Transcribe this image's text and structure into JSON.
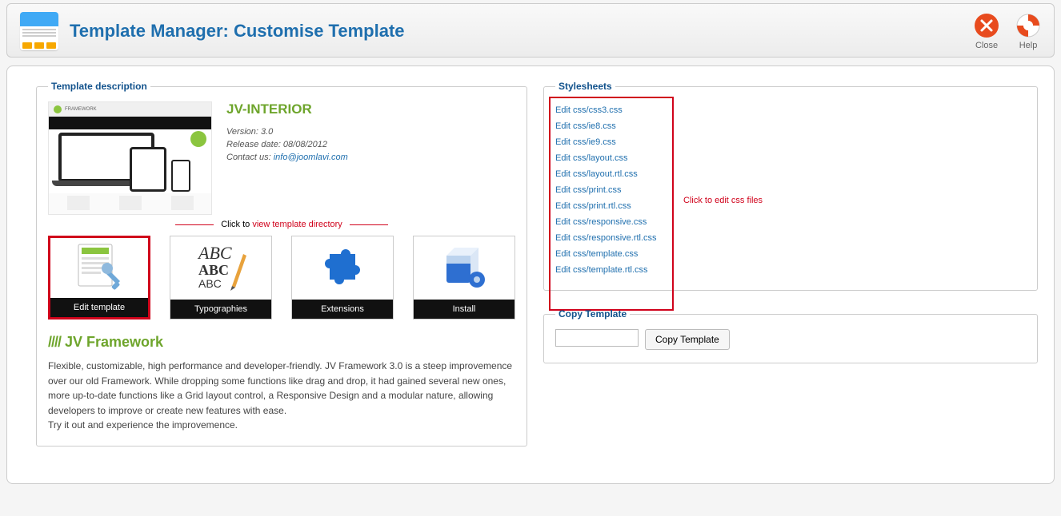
{
  "header": {
    "title": "Template Manager: Customise Template",
    "close_label": "Close",
    "help_label": "Help"
  },
  "desc": {
    "legend": "Template description",
    "template_name": "JV-INTERIOR",
    "version_label": "Version: 3.0",
    "release_label": "Release date: 08/08/2012",
    "contact_label": "Contact us: ",
    "contact_email": "info@joomlavi.com",
    "annot_prefix": "Click to ",
    "annot_text": "view template directory",
    "cards": {
      "edit_template": "Edit template",
      "typographies": "Typographies",
      "extensions": "Extensions",
      "install": "Install"
    },
    "framework_prefix": "////",
    "framework_title": " JV Framework",
    "body1": "Flexible, customizable, high performance and developer-friendly. JV Framework 3.0 is a steep improvemence over our old Framework. While dropping some functions like drag and drop, it had gained several new ones, more up-to-date functions like a Grid layout control, a Responsive Design and a modular nature, allowing developers to improve or create new features with ease.",
    "body2": "Try it out and experience the improvemence."
  },
  "stylesheets": {
    "legend": "Stylesheets",
    "annot": "Click to edit css files",
    "items": [
      "Edit css/css3.css",
      "Edit css/ie8.css",
      "Edit css/ie9.css",
      "Edit css/layout.css",
      "Edit css/layout.rtl.css",
      "Edit css/print.css",
      "Edit css/print.rtl.css",
      "Edit css/responsive.css",
      "Edit css/responsive.rtl.css",
      "Edit css/template.css",
      "Edit css/template.rtl.css"
    ]
  },
  "copy": {
    "legend": "Copy Template",
    "button": "Copy Template"
  }
}
